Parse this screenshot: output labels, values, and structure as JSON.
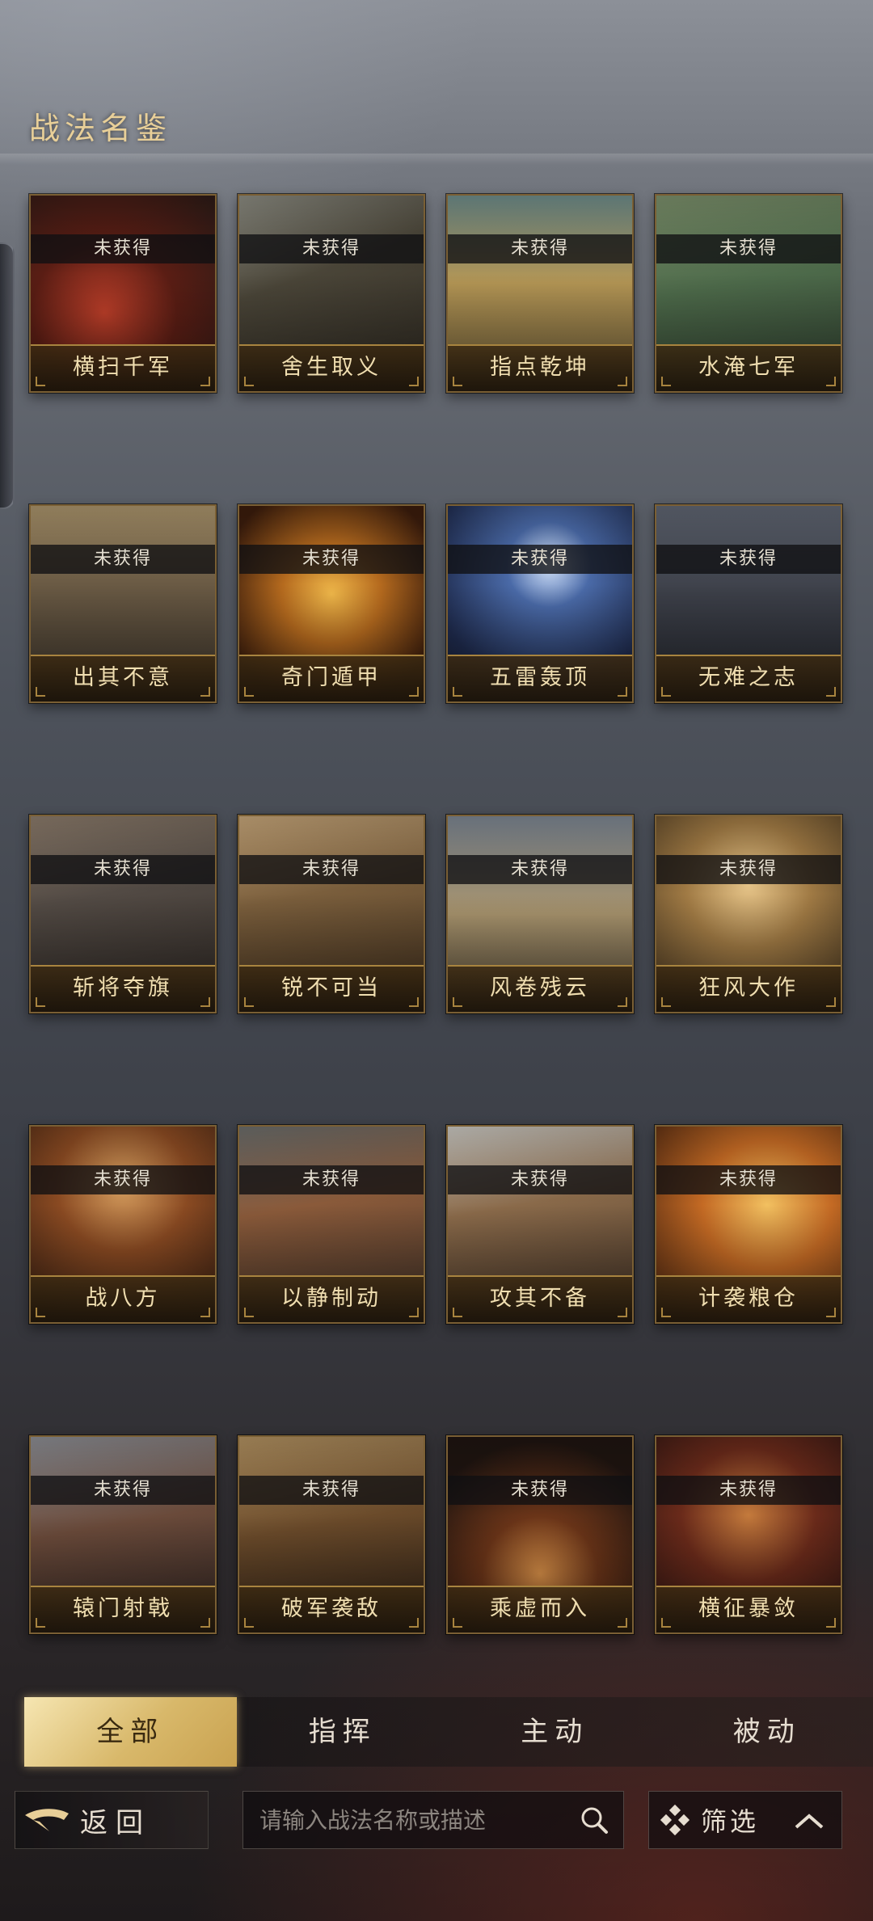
{
  "header": {
    "title": "战法名鉴"
  },
  "status_label": "未获得",
  "cards": [
    {
      "name": "横扫千军",
      "status": "未获得"
    },
    {
      "name": "舍生取义",
      "status": "未获得"
    },
    {
      "name": "指点乾坤",
      "status": "未获得"
    },
    {
      "name": "水淹七军",
      "status": "未获得"
    },
    {
      "name": "出其不意",
      "status": "未获得"
    },
    {
      "name": "奇门遁甲",
      "status": "未获得"
    },
    {
      "name": "五雷轰顶",
      "status": "未获得"
    },
    {
      "name": "无难之志",
      "status": "未获得"
    },
    {
      "name": "斩将夺旗",
      "status": "未获得"
    },
    {
      "name": "锐不可当",
      "status": "未获得"
    },
    {
      "name": "风卷残云",
      "status": "未获得"
    },
    {
      "name": "狂风大作",
      "status": "未获得"
    },
    {
      "name": "战八方",
      "status": "未获得"
    },
    {
      "name": "以静制动",
      "status": "未获得"
    },
    {
      "name": "攻其不备",
      "status": "未获得"
    },
    {
      "name": "计袭粮仓",
      "status": "未获得"
    },
    {
      "name": "辕门射戟",
      "status": "未获得"
    },
    {
      "name": "破军袭敌",
      "status": "未获得"
    },
    {
      "name": "乘虚而入",
      "status": "未获得"
    },
    {
      "name": "横征暴敛",
      "status": "未获得"
    }
  ],
  "tabs": [
    {
      "label": "全部",
      "active": true
    },
    {
      "label": "指挥",
      "active": false
    },
    {
      "label": "主动",
      "active": false
    },
    {
      "label": "被动",
      "active": false
    }
  ],
  "bottom": {
    "back_label": "返回",
    "search_placeholder": "请输入战法名称或描述",
    "search_value": "",
    "filter_label": "筛选"
  },
  "colors": {
    "accent_gold": "#e8cf98",
    "card_border": "#7a5f34",
    "active_tab": "#d8b86a"
  },
  "icons": {
    "back": "back-arrow-icon",
    "search": "search-icon",
    "filter": "filter-diamond-icon",
    "expand": "chevron-up-icon"
  }
}
